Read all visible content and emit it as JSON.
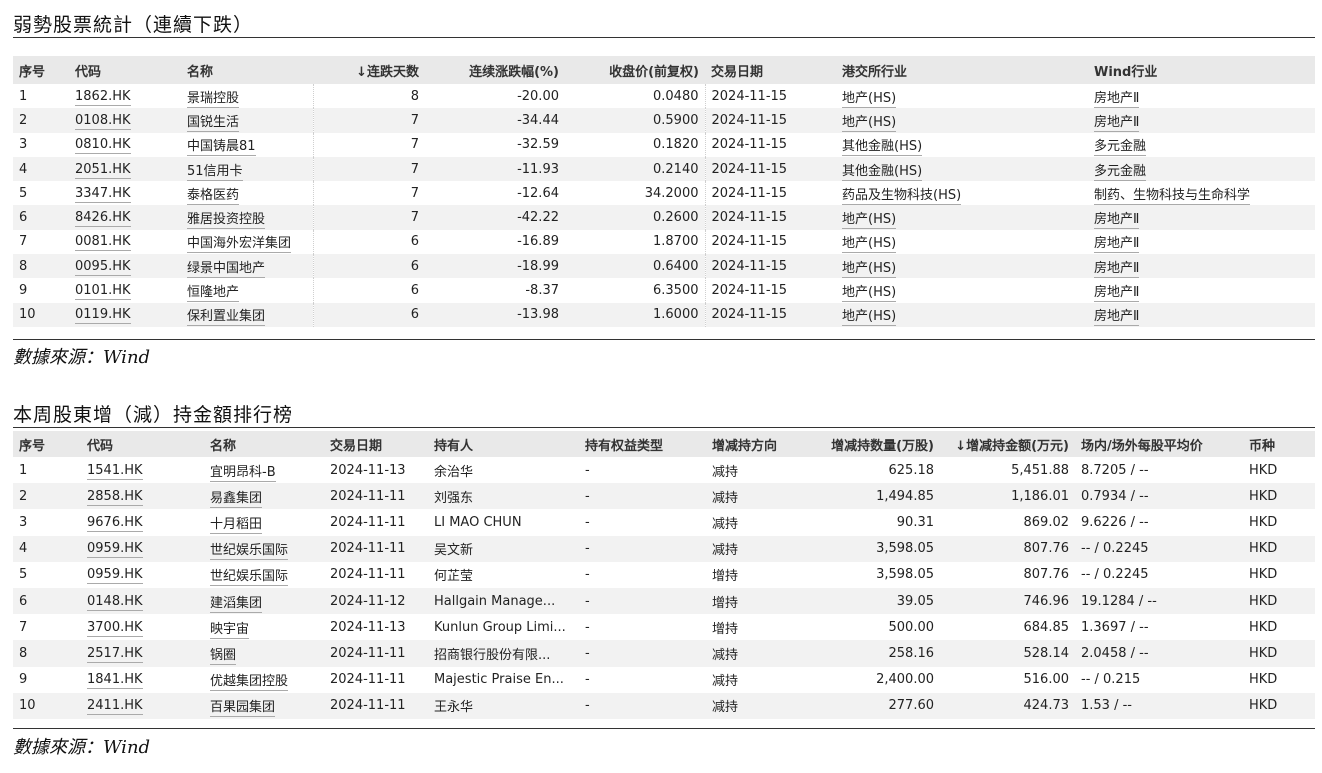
{
  "section1": {
    "title": "弱勢股票統計（連續下跌）",
    "source": "數據來源：Wind",
    "headers": [
      "序号",
      "代码",
      "名称",
      "↓连跌天数",
      "连续涨跌幅(%)",
      "收盘价(前复权)",
      "交易日期",
      "港交所行业",
      "Wind行业"
    ],
    "rows": [
      [
        "1",
        "1862.HK",
        "景瑞控股",
        "8",
        "-20.00",
        "0.0480",
        "2024-11-15",
        "地产(HS)",
        "房地产Ⅱ"
      ],
      [
        "2",
        "0108.HK",
        "国锐生活",
        "7",
        "-34.44",
        "0.5900",
        "2024-11-15",
        "地产(HS)",
        "房地产Ⅱ"
      ],
      [
        "3",
        "0810.HK",
        "中国铸晨81",
        "7",
        "-32.59",
        "0.1820",
        "2024-11-15",
        "其他金融(HS)",
        "多元金融"
      ],
      [
        "4",
        "2051.HK",
        "51信用卡",
        "7",
        "-11.93",
        "0.2140",
        "2024-11-15",
        "其他金融(HS)",
        "多元金融"
      ],
      [
        "5",
        "3347.HK",
        "泰格医药",
        "7",
        "-12.64",
        "34.2000",
        "2024-11-15",
        "药品及生物科技(HS)",
        "制药、生物科技与生命科学"
      ],
      [
        "6",
        "8426.HK",
        "雅居投资控股",
        "7",
        "-42.22",
        "0.2600",
        "2024-11-15",
        "地产(HS)",
        "房地产Ⅱ"
      ],
      [
        "7",
        "0081.HK",
        "中国海外宏洋集团",
        "6",
        "-16.89",
        "1.8700",
        "2024-11-15",
        "地产(HS)",
        "房地产Ⅱ"
      ],
      [
        "8",
        "0095.HK",
        "绿景中国地产",
        "6",
        "-18.99",
        "0.6400",
        "2024-11-15",
        "地产(HS)",
        "房地产Ⅱ"
      ],
      [
        "9",
        "0101.HK",
        "恒隆地产",
        "6",
        "-8.37",
        "6.3500",
        "2024-11-15",
        "地产(HS)",
        "房地产Ⅱ"
      ],
      [
        "10",
        "0119.HK",
        "保利置业集团",
        "6",
        "-13.98",
        "1.6000",
        "2024-11-15",
        "地产(HS)",
        "房地产Ⅱ"
      ]
    ]
  },
  "section2": {
    "title": "本周股東增（減）持金額排行榜",
    "source": "數據來源：Wind",
    "headers": [
      "序号",
      "代码",
      "名称",
      "交易日期",
      "持有人",
      "持有权益类型",
      "增减持方向",
      "增减持数量(万股)",
      "↓增减持金额(万元)",
      "场内/场外每股平均价",
      "币种"
    ],
    "rows": [
      [
        "1",
        "1541.HK",
        "宜明昂科-B",
        "2024-11-13",
        "余治华",
        "-",
        "减持",
        "625.18",
        "5,451.88",
        "8.7205 / --",
        "HKD"
      ],
      [
        "2",
        "2858.HK",
        "易鑫集团",
        "2024-11-11",
        "刘强东",
        "-",
        "减持",
        "1,494.85",
        "1,186.01",
        "0.7934 / --",
        "HKD"
      ],
      [
        "3",
        "9676.HK",
        "十月稻田",
        "2024-11-11",
        "LI MAO CHUN",
        "-",
        "减持",
        "90.31",
        "869.02",
        "9.6226 / --",
        "HKD"
      ],
      [
        "4",
        "0959.HK",
        "世纪娱乐国际",
        "2024-11-11",
        "吴文新",
        "-",
        "减持",
        "3,598.05",
        "807.76",
        "-- / 0.2245",
        "HKD"
      ],
      [
        "5",
        "0959.HK",
        "世纪娱乐国际",
        "2024-11-11",
        "何芷莹",
        "-",
        "增持",
        "3,598.05",
        "807.76",
        "-- / 0.2245",
        "HKD"
      ],
      [
        "6",
        "0148.HK",
        "建滔集团",
        "2024-11-12",
        "Hallgain Manage...",
        "-",
        "增持",
        "39.05",
        "746.96",
        "19.1284 / --",
        "HKD"
      ],
      [
        "7",
        "3700.HK",
        "映宇宙",
        "2024-11-13",
        "Kunlun Group Limi...",
        "-",
        "增持",
        "500.00",
        "684.85",
        "1.3697 / --",
        "HKD"
      ],
      [
        "8",
        "2517.HK",
        "锅圈",
        "2024-11-11",
        "招商银行股份有限...",
        "-",
        "减持",
        "258.16",
        "528.14",
        "2.0458 / --",
        "HKD"
      ],
      [
        "9",
        "1841.HK",
        "优越集团控股",
        "2024-11-11",
        "Majestic Praise En...",
        "-",
        "减持",
        "2,400.00",
        "516.00",
        "-- / 0.215",
        "HKD"
      ],
      [
        "10",
        "2411.HK",
        "百果园集团",
        "2024-11-11",
        "王永华",
        "-",
        "减持",
        "277.60",
        "424.73",
        "1.53 / --",
        "HKD"
      ]
    ]
  }
}
